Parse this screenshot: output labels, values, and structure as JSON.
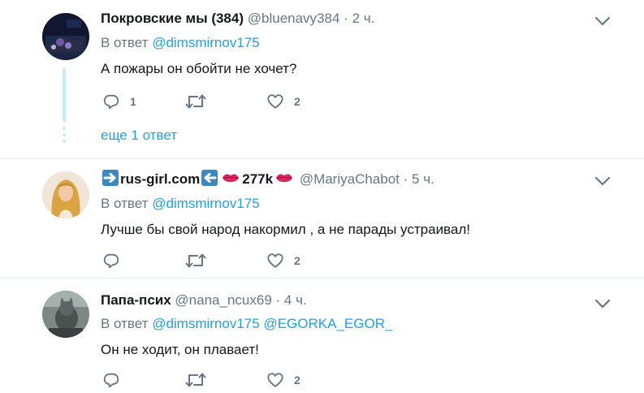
{
  "tweets": [
    {
      "name": "Покровские мы (384)",
      "handle": "@bluenavy384",
      "dot": "·",
      "time": "2 ч.",
      "reply_prefix": "В ответ",
      "reply_to": [
        "@dimsmirnov175"
      ],
      "text": "А пожары он обойти не хочет?",
      "replies": "1",
      "retweets": "",
      "likes": "2",
      "avatar_colors": [
        "#0f1426",
        "#5b4b8a",
        "#c8c2d8"
      ]
    },
    {
      "name_parts": [
        "rus-girl.com",
        "277k"
      ],
      "handle": "@MariyaChabot",
      "dot": "·",
      "time": "5 ч.",
      "reply_prefix": "В ответ",
      "reply_to": [
        "@dimsmirnov175"
      ],
      "text": "Лучше бы свой народ накормил , а не парады устраивал!",
      "replies": "",
      "retweets": "",
      "likes": "2",
      "avatar_colors": [
        "#e8d5b8",
        "#d9a441",
        "#f4e9dc"
      ]
    },
    {
      "name": "Папа-псих",
      "handle": "@nana_ncux69",
      "dot": "·",
      "time": "4 ч.",
      "reply_prefix": "В ответ",
      "reply_to": [
        "@dimsmirnov175",
        "@EGORKA_EGOR_"
      ],
      "text": "Он не ходит, он плавает!",
      "replies": "",
      "retweets": "",
      "likes": "2",
      "avatar_colors": [
        "#6e7a78",
        "#8d9a96",
        "#3f4645"
      ]
    }
  ],
  "more_replies": "еще 1 ответ",
  "colors": {
    "link": "#1da1f2",
    "muted": "#657786",
    "text": "#14171a",
    "divider": "#e6ecf0",
    "thread": "#c4ecfb",
    "emoji_arrow": "#3b88c3",
    "lips": "#e0245e"
  },
  "icons": [
    "reply-icon",
    "retweet-icon",
    "like-icon",
    "chevron-down-icon",
    "right-arrow-emoji-icon",
    "left-arrow-emoji-icon",
    "kiss-lips-emoji-icon"
  ]
}
